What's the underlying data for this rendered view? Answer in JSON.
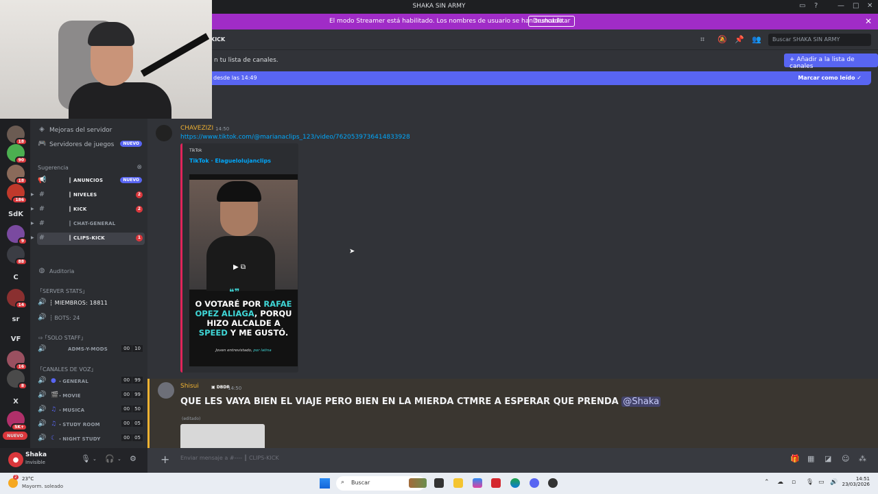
{
  "window": {
    "title": "SHAKA SIN ARMY"
  },
  "streamer_banner": {
    "message": "El modo Streamer está habilitado. Los nombres de usuario se han truncado.",
    "button": "Deshabilitar"
  },
  "header": {
    "channel_fragment": "KICK",
    "search_placeholder": "Buscar SHAKA SIN ARMY"
  },
  "notice": {
    "text": "n tu lista de canales.",
    "button": "Añadir a la lista de canales"
  },
  "new_messages": {
    "left": "desde las 14:49",
    "right": "Marcar como leído"
  },
  "server_list": [
    {
      "label": "",
      "badge": "18",
      "color": "#6b5b52"
    },
    {
      "label": "",
      "badge": "90",
      "color": "#4caf50"
    },
    {
      "label": "",
      "badge": "18",
      "color": "#8a6a5a"
    },
    {
      "label": "",
      "badge": "186",
      "color": "#c0392b"
    },
    {
      "label": "SdK",
      "badge": ""
    },
    {
      "label": "",
      "badge": "9",
      "color": "#7a4aa0"
    },
    {
      "label": "",
      "badge": "88",
      "color": "#3b3d44"
    },
    {
      "label": "C",
      "badge": ""
    },
    {
      "label": "",
      "badge": "14",
      "color": "#8a3030"
    },
    {
      "label": "sr",
      "badge": ""
    },
    {
      "label": "VF",
      "badge": ""
    },
    {
      "label": "",
      "badge": "16",
      "color": "#9a5060"
    },
    {
      "label": "",
      "badge": "8",
      "color": "#4a4a4a"
    },
    {
      "label": "X",
      "badge": ""
    },
    {
      "label": "",
      "badge": "5K+",
      "color": "#b0306a"
    },
    {
      "label": "NUEVO",
      "badge": ""
    }
  ],
  "sidebar": {
    "boosts": "Mejoras del servidor",
    "game_servers": "Servidores de juegos",
    "new_pill": "NUEVO",
    "suggestion": "Sugerencia",
    "text_channels": [
      {
        "name": "║ ANUNCIOS",
        "badge": "NUEVO"
      },
      {
        "name": "║ NIVELES",
        "badge": "2"
      },
      {
        "name": "║ KICK",
        "badge": "2"
      },
      {
        "name": "║ CHAT-GENERAL",
        "badge": ""
      },
      {
        "name": "║ CLIPS-KICK",
        "badge": "1"
      }
    ],
    "audit": "Auditoria",
    "cat_server_stats": "｢SERVER STATS｣",
    "members": "┆ MIEMBROS: 18811",
    "bots": "┆ BOTS: 24",
    "cat_staff": "｢SOLO STAFF｣",
    "adms": "ADMS-Y-MODS",
    "adms_count": [
      "00",
      "10"
    ],
    "cat_voice": "｢CANALES DE VOZ｣",
    "voice": [
      {
        "name": "・GENERAL",
        "count": [
          "00",
          "99"
        ]
      },
      {
        "name": "・MOVIE",
        "count": [
          "00",
          "99"
        ]
      },
      {
        "name": "・MUSICA",
        "count": [
          "00",
          "50"
        ]
      },
      {
        "name": "・STUDY ROOM",
        "count": [
          "00",
          "05"
        ]
      },
      {
        "name": "・NIGHT STUDY",
        "count": [
          "00",
          "05"
        ]
      }
    ]
  },
  "user_panel": {
    "name": "Shaka",
    "status": "Invisible"
  },
  "messages": {
    "m1": {
      "author": "CHAVEZIZI",
      "time": "14:50",
      "link": "https://www.tiktok.com/@marianaclips_123/video/7620539736414833928",
      "embed_provider": "TikTok",
      "embed_title": "TikTok · Elaguelolujanclips",
      "video_lines": [
        "O VOTARÉ POR ",
        "RAFAE",
        "OPEZ ALIAGA",
        ", PORQU",
        "HIZO ALCALDE A",
        "SPEED",
        " Y ME GUSTÓ."
      ],
      "video_footer": "Joven entrevistado, ",
      "video_footer_2": "por latina"
    },
    "m2": {
      "author": "Shisui",
      "tag": "DBDR",
      "time": "14:50",
      "text": "QUE LES VAYA BIEN EL VIAJE PERO BIEN EN LA MIERDA CTMRE A ESPERAR QUE PRENDA ",
      "mention": "@Shaka",
      "edited": "(editado)"
    }
  },
  "composer": {
    "placeholder": "Enviar mensaje a #---- ║ CLIPS-KICK"
  },
  "taskbar": {
    "temp": "23°C",
    "weather": "Mayorm. soleado",
    "weather_badge": "2",
    "search": "Buscar",
    "time": "14:51",
    "date": "23/03/2026"
  },
  "colors": {
    "streamer": "#a02cc7",
    "blurple": "#5865f2",
    "mention_highlight": "#f0b232",
    "link": "#00a8fc"
  }
}
